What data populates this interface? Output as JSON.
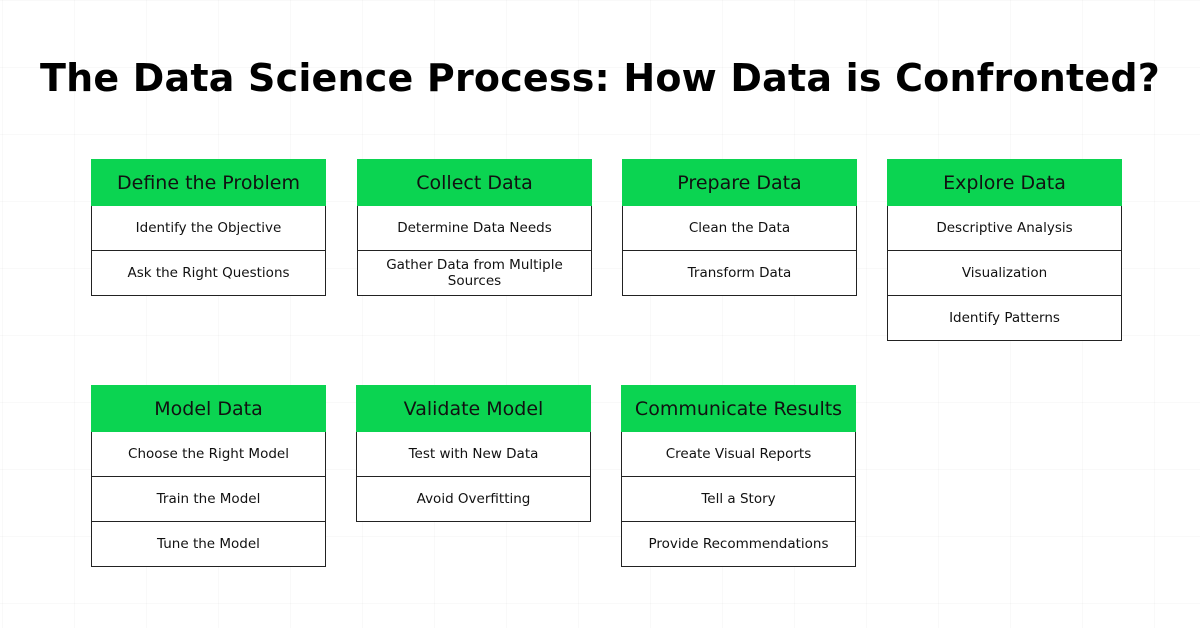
{
  "title": "The Data Science Process: How Data is Confronted?",
  "colors": {
    "header_green": "#0bd451",
    "border": "#222222",
    "text": "#111111"
  },
  "steps": [
    {
      "heading": "Define the Problem",
      "items": [
        "Identify the Objective",
        "Ask the Right Questions"
      ]
    },
    {
      "heading": "Collect Data",
      "items": [
        "Determine Data Needs",
        "Gather Data from Multiple Sources"
      ]
    },
    {
      "heading": "Prepare Data",
      "items": [
        "Clean the Data",
        "Transform Data"
      ]
    },
    {
      "heading": "Explore Data",
      "items": [
        "Descriptive Analysis",
        "Visualization",
        "Identify Patterns"
      ]
    },
    {
      "heading": "Model Data",
      "items": [
        "Choose the Right Model",
        "Train the Model",
        "Tune the Model"
      ]
    },
    {
      "heading": "Validate Model",
      "items": [
        "Test with New Data",
        "Avoid Overfitting"
      ]
    },
    {
      "heading": "Communicate Results",
      "items": [
        "Create Visual Reports",
        "Tell a Story",
        "Provide Recommendations"
      ]
    }
  ]
}
